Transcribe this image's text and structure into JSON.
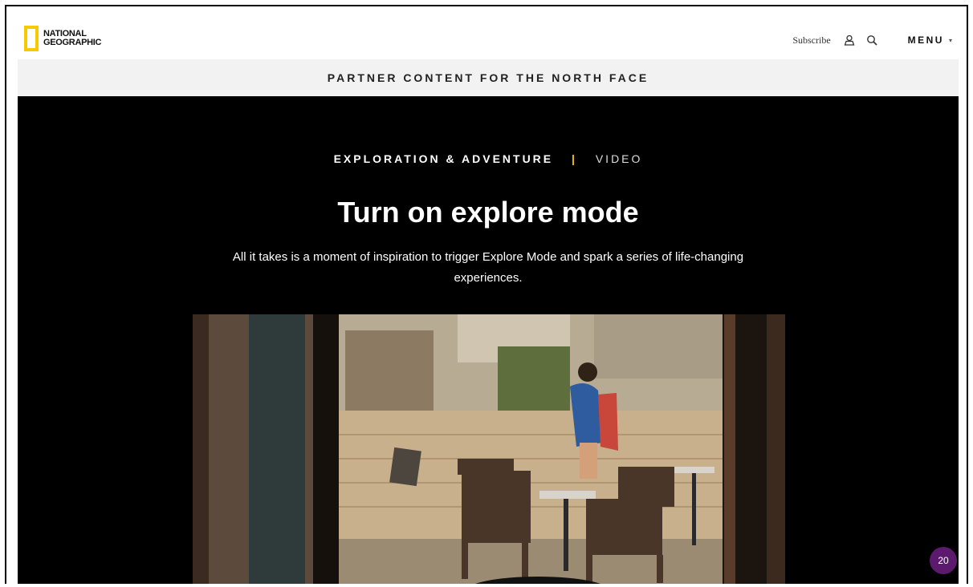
{
  "header": {
    "logo_line1": "NATIONAL",
    "logo_line2": "GEOGRAPHIC",
    "subscribe_label": "Subscribe",
    "account_icon": "user-icon",
    "search_icon": "search-icon",
    "menu_label": "MENU",
    "menu_caret": "▾"
  },
  "partner_banner": {
    "text": "PARTNER CONTENT FOR THE NORTH FACE"
  },
  "hero": {
    "category": "EXPLORATION & ADVENTURE",
    "separator": "|",
    "type": "VIDEO",
    "title": "Turn on explore mode",
    "dek": "All it takes is a moment of inspiration to trigger Explore Mode and spark a series of life-changing experiences."
  },
  "video": {
    "description_icon": "video-thumbnail"
  },
  "floating_badge": {
    "value": "20",
    "color": "#5b1a6e"
  },
  "colors": {
    "brand_yellow": "#f6c900",
    "hero_background": "#000000",
    "banner_background": "#f2f2f2"
  }
}
